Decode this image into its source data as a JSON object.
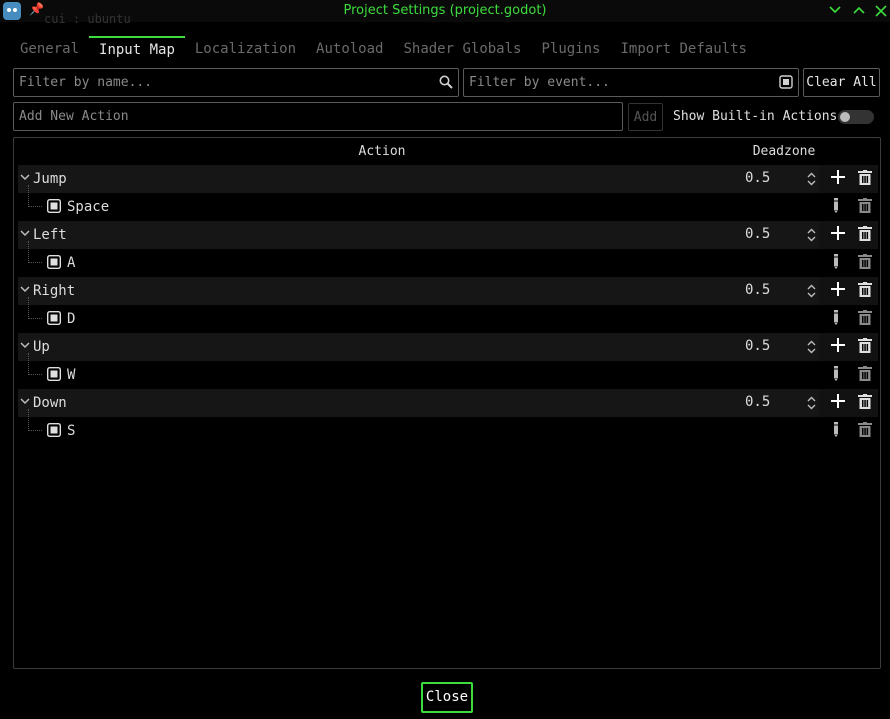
{
  "window": {
    "title": "Project Settings (project.godot)",
    "ghost_title": "  cui :  ubuntu"
  },
  "tabs": [
    "General",
    "Input Map",
    "Localization",
    "Autoload",
    "Shader Globals",
    "Plugins",
    "Import Defaults"
  ],
  "active_tab": "Input Map",
  "filters": {
    "name_placeholder": "Filter by name...",
    "event_placeholder": "Filter by event...",
    "clear_all": "Clear All"
  },
  "add_action": {
    "placeholder": "Add New Action",
    "add_label": "Add",
    "builtin_label": "Show Built-in Actions",
    "builtin_enabled": false
  },
  "tree": {
    "col_action": "Action",
    "col_deadzone": "Deadzone",
    "actions": [
      {
        "name": "Jump",
        "deadzone": "0.5",
        "event": "Space"
      },
      {
        "name": "Left",
        "deadzone": "0.5",
        "event": "A"
      },
      {
        "name": "Right",
        "deadzone": "0.5",
        "event": "D"
      },
      {
        "name": "Up",
        "deadzone": "0.5",
        "event": "W"
      },
      {
        "name": "Down",
        "deadzone": "0.5",
        "event": "S"
      }
    ]
  },
  "footer": {
    "close_label": "Close"
  },
  "colors": {
    "accent": "#3ddc3d",
    "background": "#000000"
  }
}
